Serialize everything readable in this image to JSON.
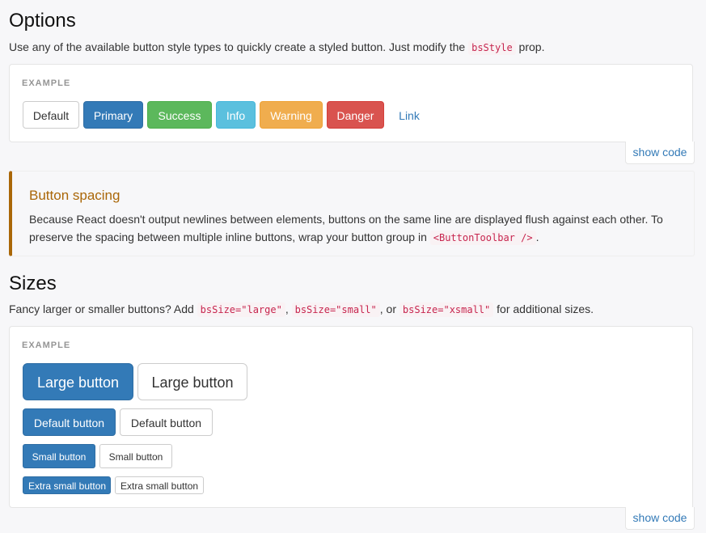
{
  "options": {
    "heading": "Options",
    "lead_before": "Use any of the available button style types to quickly create a styled button. Just modify the ",
    "lead_code": "bsStyle",
    "lead_after": " prop.",
    "example_label": "EXAMPLE",
    "buttons": {
      "default": "Default",
      "primary": "Primary",
      "success": "Success",
      "info": "Info",
      "warning": "Warning",
      "danger": "Danger",
      "link": "Link"
    },
    "show_code": "show code"
  },
  "callout": {
    "title": "Button spacing",
    "text_before": "Because React doesn't output newlines between elements, buttons on the same line are displayed flush against each other. To preserve the spacing between multiple inline buttons, wrap your button group in ",
    "code": "<ButtonToolbar />",
    "text_after": "."
  },
  "sizes": {
    "heading": "Sizes",
    "lead_before": "Fancy larger or smaller buttons? Add ",
    "code_large": "bsSize=\"large\"",
    "sep1": ", ",
    "code_small": "bsSize=\"small\"",
    "sep2": ", or ",
    "code_xsmall": "bsSize=\"xsmall\"",
    "lead_after": " for additional sizes.",
    "example_label": "EXAMPLE",
    "large": "Large button",
    "default": "Default button",
    "small": "Small button",
    "xsmall": "Extra small button",
    "show_code": "show code"
  },
  "colors": {
    "primary": "#337ab7",
    "success": "#5cb85c",
    "info": "#5bc0de",
    "warning": "#f0ad4e",
    "danger": "#d9534f",
    "callout_accent": "#aa6708"
  }
}
